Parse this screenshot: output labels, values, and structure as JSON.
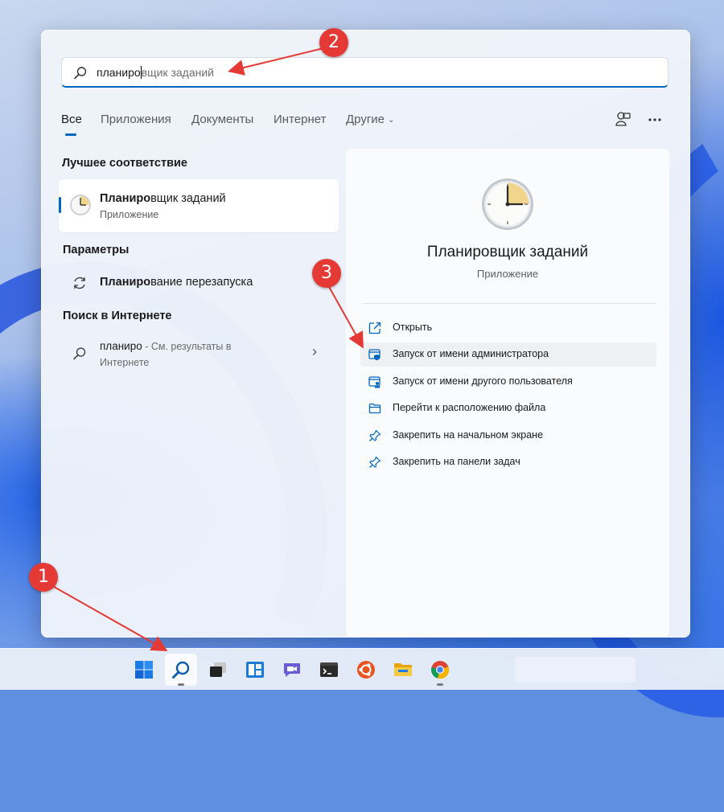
{
  "search": {
    "typed": "планиро",
    "suggestion": "вщик заданий"
  },
  "tabs": [
    {
      "label": "Все"
    },
    {
      "label": "Приложения"
    },
    {
      "label": "Документы"
    },
    {
      "label": "Интернет"
    },
    {
      "label": "Другие"
    }
  ],
  "best_match": {
    "section": "Лучшее соответствие",
    "name_bold": "Планиро",
    "name_rest": "вщик заданий",
    "type": "Приложение"
  },
  "settings": {
    "section": "Параметры",
    "item_bold": "Планиро",
    "item_rest": "вание перезапуска"
  },
  "web": {
    "section": "Поиск в Интернете",
    "query": "планиро",
    "hint": " - См. результаты в",
    "hint2": "Интернете"
  },
  "detail": {
    "title": "Планировщик заданий",
    "subtitle": "Приложение",
    "actions": [
      {
        "label": "Открыть",
        "icon": "open-external-icon"
      },
      {
        "label": "Запуск от имени администратора",
        "icon": "run-as-admin-icon"
      },
      {
        "label": "Запуск от имени другого пользователя",
        "icon": "run-as-other-user-icon"
      },
      {
        "label": "Перейти к расположению файла",
        "icon": "folder-icon"
      },
      {
        "label": "Закрепить на начальном экране",
        "icon": "pin-icon"
      },
      {
        "label": "Закрепить на панели задач",
        "icon": "pin-icon"
      }
    ]
  },
  "annotations": {
    "badge1": "1",
    "badge2": "2",
    "badge3": "3",
    "color": "#e53935"
  },
  "taskbar": {
    "apps": [
      "windows-start-icon",
      "search-icon",
      "task-view-icon",
      "widgets-icon",
      "teams-chat-icon",
      "terminal-icon",
      "ubuntu-icon",
      "file-explorer-icon",
      "chrome-icon"
    ]
  },
  "colors": {
    "accent": "#0067c0"
  }
}
